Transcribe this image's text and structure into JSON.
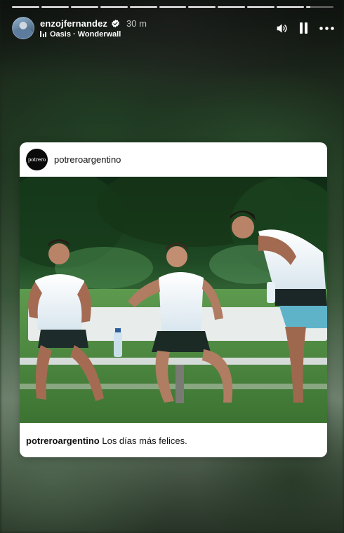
{
  "story": {
    "progress_segments": 11,
    "progress_filled": 10,
    "current_progress": 0.15,
    "author": {
      "username": "enzojfernandez",
      "verified": true,
      "time_ago": "30 m",
      "avatar_icon": "avatar-icon"
    },
    "music": {
      "label": "Oasis · Wonderwall",
      "icon": "music-equalizer-icon"
    },
    "controls": {
      "volume_icon": "volume-icon",
      "pause_icon": "pause-icon",
      "more_icon": "more-options-icon"
    }
  },
  "shared_post": {
    "account": {
      "avatar_text": "potrero",
      "username": "potreroargentino"
    },
    "caption": {
      "username": "potreroargentino",
      "text": "Los días más felices."
    },
    "photo_icon": "team-training-photo"
  },
  "colors": {
    "card_bg": "#ffffff",
    "text_primary": "#111111",
    "overlay_text": "#ffffff"
  }
}
